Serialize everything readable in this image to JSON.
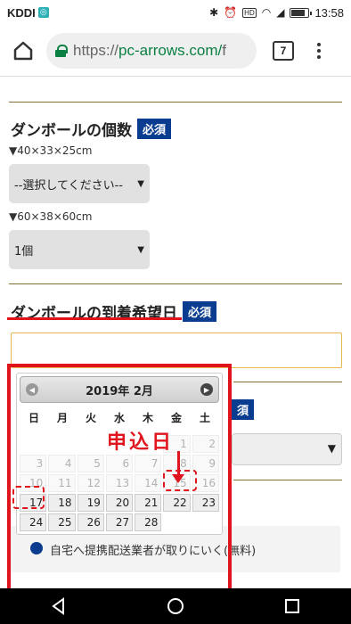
{
  "status_bar": {
    "carrier": "KDDI",
    "time": "13:58",
    "hd": "HD"
  },
  "browser": {
    "url_scheme": "https://",
    "url_host": "pc-arrows.com/",
    "url_rest": "f",
    "tab_count": "7"
  },
  "form": {
    "box_section": {
      "title": "ダンボールの個数",
      "required": "必須",
      "size1_label": "▼40×33×25cm",
      "size1_value": "--選択してください--",
      "size2_label": "▼60×38×60cm",
      "size2_value": "1個"
    },
    "arrival_section": {
      "title": "ダンボールの到着希望日",
      "required": "必須",
      "date_value": "",
      "second_required": "須"
    },
    "pickup_option": "自宅へ提携配送業者が取りにいく(無料)"
  },
  "calendar": {
    "title": "2019年 2月",
    "weekdays": [
      "日",
      "月",
      "火",
      "水",
      "木",
      "金",
      "土"
    ],
    "weeks": [
      [
        "",
        "",
        "",
        "",
        "",
        "1",
        "2"
      ],
      [
        "3",
        "4",
        "5",
        "6",
        "7",
        "8",
        "9"
      ],
      [
        "10",
        "11",
        "12",
        "13",
        "14",
        "15",
        "16"
      ],
      [
        "17",
        "18",
        "19",
        "20",
        "21",
        "22",
        "23"
      ],
      [
        "24",
        "25",
        "26",
        "27",
        "28",
        "",
        ""
      ]
    ],
    "disabled_through": 16
  },
  "annotation": {
    "label": "申込日",
    "color": "#e0141c"
  },
  "colors": {
    "required_badge": "#0a3d8f",
    "url_green": "#0b8043",
    "highlight_red": "#e0141c",
    "rule_brown": "#8a6b3a"
  }
}
